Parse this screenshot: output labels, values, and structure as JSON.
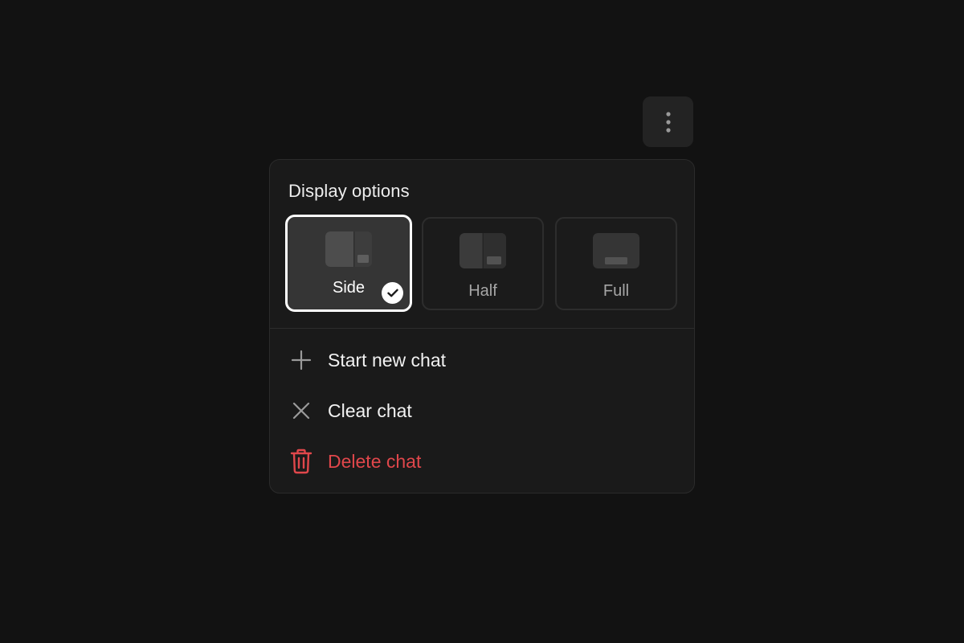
{
  "more_button": {
    "icon": "more-vertical-icon"
  },
  "menu": {
    "title": "Display options",
    "options": [
      {
        "label": "Side",
        "icon": "side-layout-icon",
        "selected": true
      },
      {
        "label": "Half",
        "icon": "half-layout-icon",
        "selected": false
      },
      {
        "label": "Full",
        "icon": "full-layout-icon",
        "selected": false
      }
    ],
    "items": [
      {
        "label": "Start new chat",
        "icon": "plus-icon"
      },
      {
        "label": "Clear chat",
        "icon": "close-icon"
      },
      {
        "label": "Delete chat",
        "icon": "trash-icon",
        "danger": true
      }
    ]
  },
  "colors": {
    "background": "#121212",
    "menu_background": "#1a1a1a",
    "selected_option": "#353535",
    "danger": "#e0474b",
    "text": "#f2f2f2",
    "muted_text": "#a6a6a6"
  }
}
